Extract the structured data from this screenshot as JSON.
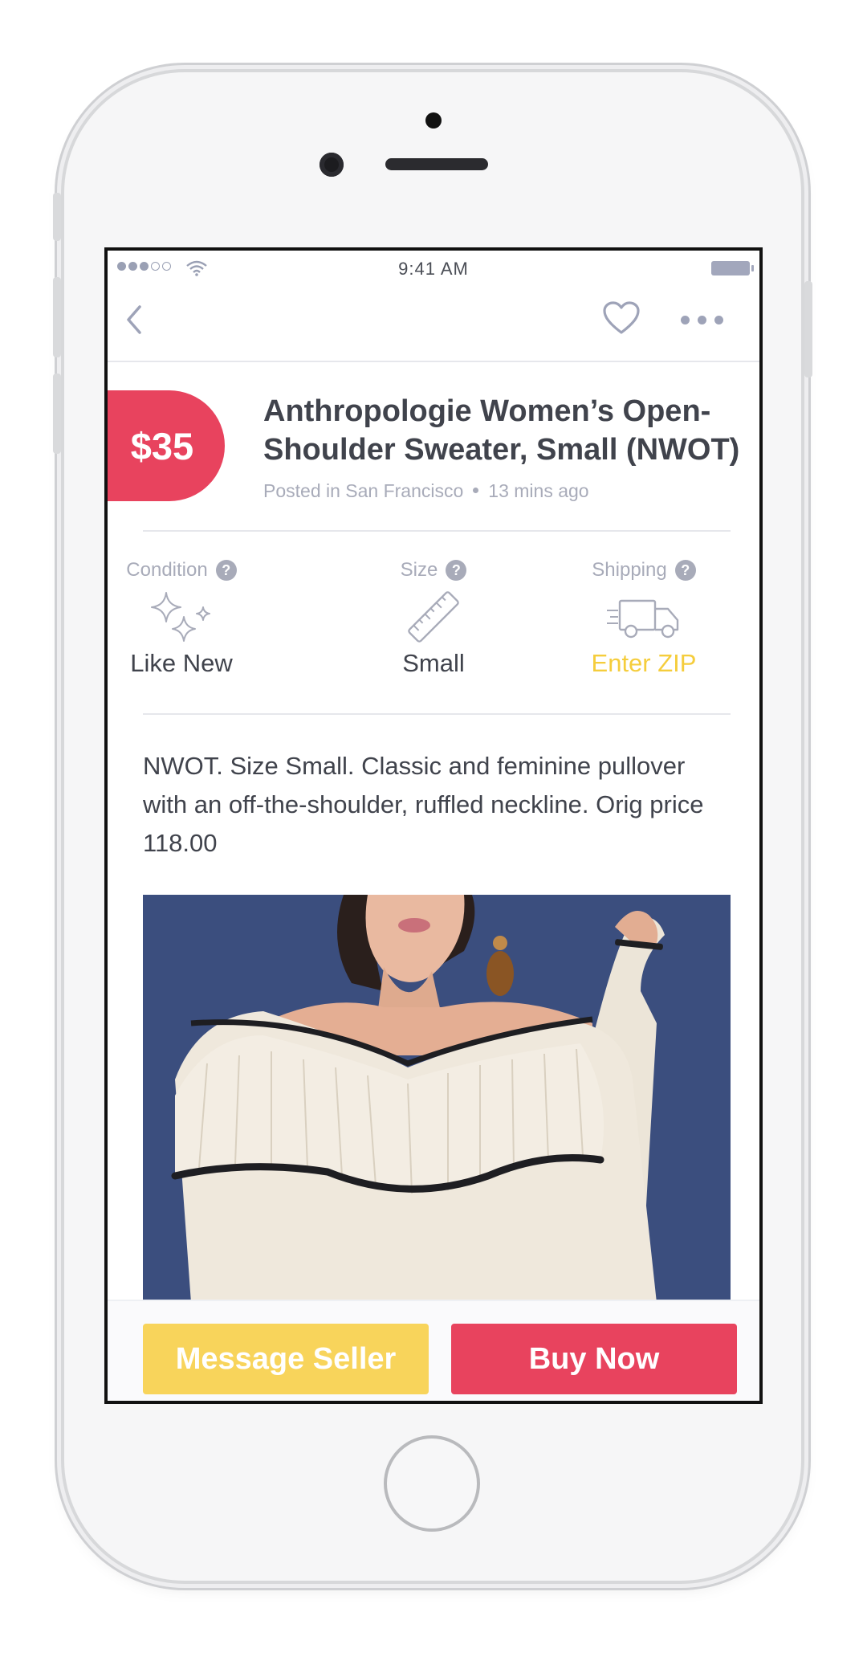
{
  "status_bar": {
    "time": "9:41 AM"
  },
  "listing": {
    "price": "$35",
    "title": "Anthropologie Women’s Open-Shoulder Sweater, Small (NWOT)",
    "posted_location": "Posted in San Francisco",
    "posted_time": "13 mins ago",
    "description": "NWOT. Size Small. Classic and feminine pullover with an off-the-shoulder, ruffled neckline. Orig price 118.00"
  },
  "attributes": {
    "condition": {
      "label": "Condition",
      "value": "Like New",
      "icon": "sparkle-icon"
    },
    "size": {
      "label": "Size",
      "value": "Small",
      "icon": "ruler-icon"
    },
    "shipping": {
      "label": "Shipping",
      "value": "Enter ZIP",
      "icon": "truck-icon"
    },
    "help_glyph": "?"
  },
  "actions": {
    "message_label": "Message Seller",
    "buy_label": "Buy Now"
  },
  "colors": {
    "accent_red": "#e8435e",
    "accent_yellow": "#f8d45b",
    "zip_yellow": "#f5cd3c",
    "text_dark": "#40434c",
    "text_muted": "#a8abb9"
  }
}
